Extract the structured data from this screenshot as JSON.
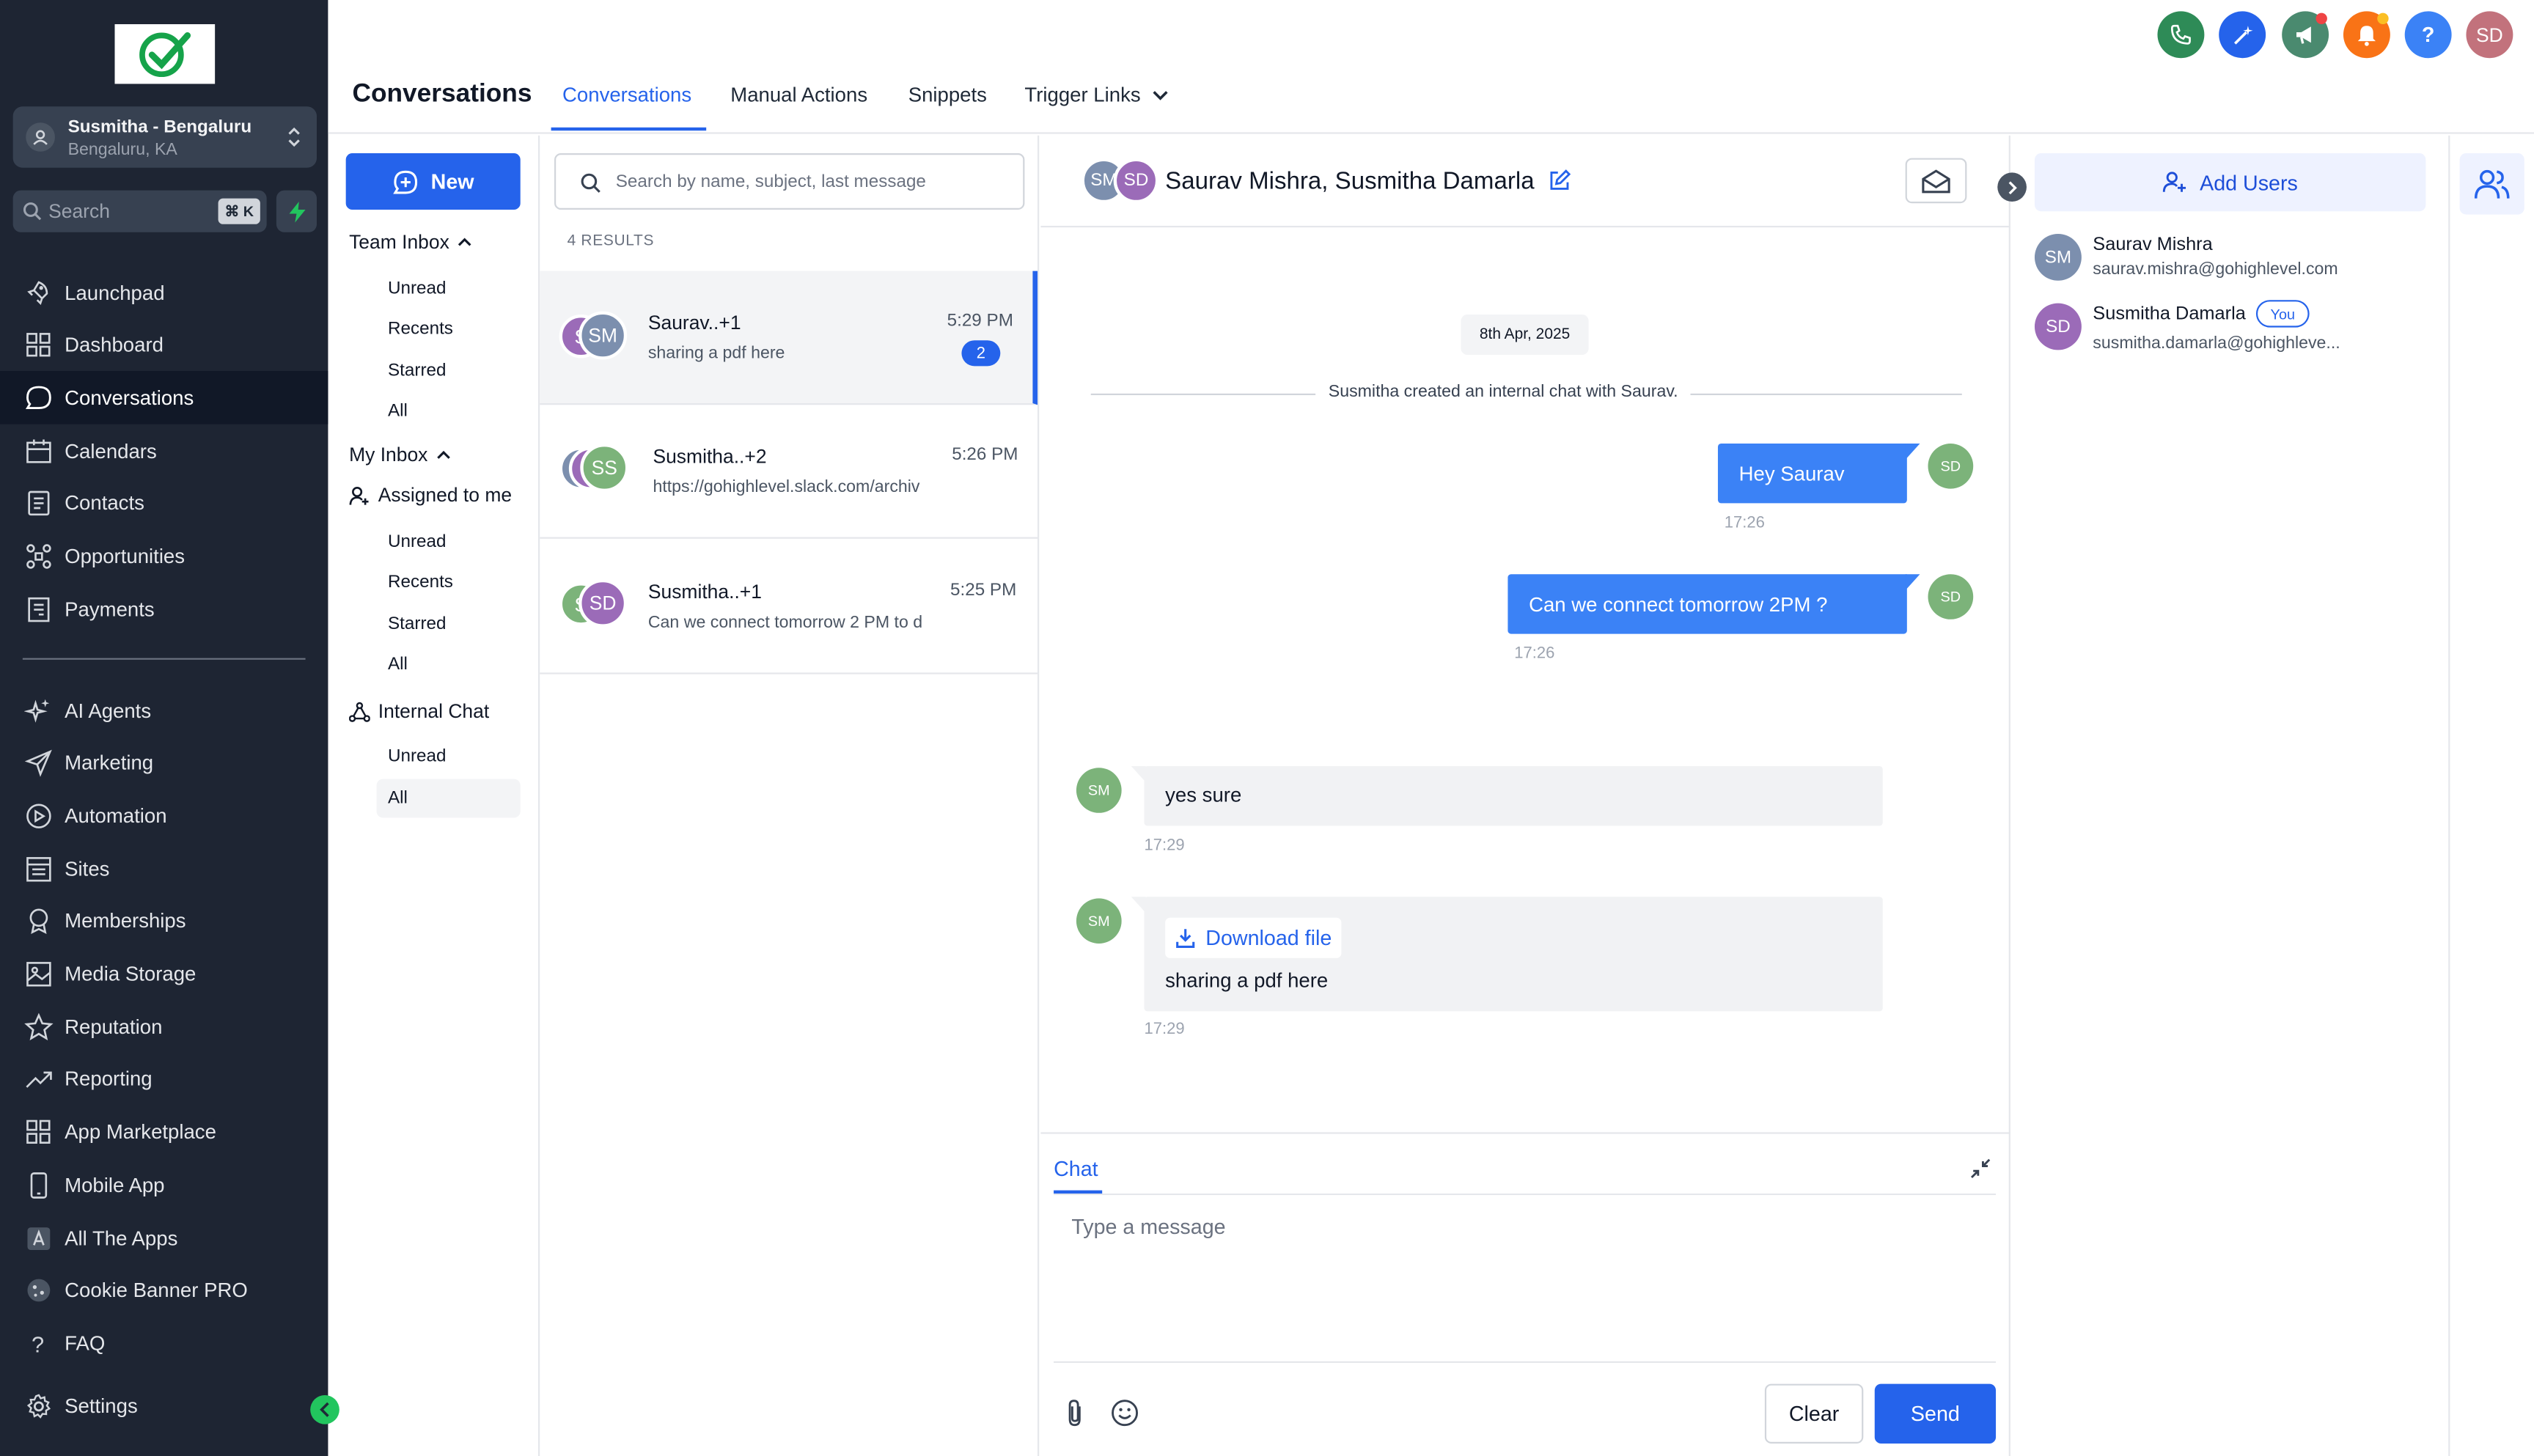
{
  "account": {
    "name": "Susmitha - Bengaluru",
    "location": "Bengaluru, KA"
  },
  "sidebar": {
    "search_placeholder": "Search",
    "search_shortcut": "⌘ K",
    "items": [
      {
        "label": "Launchpad",
        "icon": "rocket-icon"
      },
      {
        "label": "Dashboard",
        "icon": "grid-icon"
      },
      {
        "label": "Conversations",
        "icon": "chat-bubble-icon",
        "active": true
      },
      {
        "label": "Calendars",
        "icon": "calendar-icon"
      },
      {
        "label": "Contacts",
        "icon": "contacts-icon"
      },
      {
        "label": "Opportunities",
        "icon": "opportunities-icon"
      },
      {
        "label": "Payments",
        "icon": "payments-icon"
      }
    ],
    "items2": [
      {
        "label": "AI Agents",
        "icon": "sparkle-icon"
      },
      {
        "label": "Marketing",
        "icon": "send-icon"
      },
      {
        "label": "Automation",
        "icon": "automation-icon"
      },
      {
        "label": "Sites",
        "icon": "sites-icon"
      },
      {
        "label": "Memberships",
        "icon": "award-icon"
      },
      {
        "label": "Media Storage",
        "icon": "image-icon"
      },
      {
        "label": "Reputation",
        "icon": "star-icon"
      },
      {
        "label": "Reporting",
        "icon": "trending-up-icon"
      },
      {
        "label": "App Marketplace",
        "icon": "apps-icon"
      },
      {
        "label": "Mobile App",
        "icon": "mobile-icon"
      },
      {
        "label": "All The Apps",
        "icon": "app-store-icon"
      },
      {
        "label": "Cookie Banner PRO",
        "icon": "cookie-icon"
      },
      {
        "label": "FAQ",
        "icon": "question-icon"
      }
    ],
    "settings_label": "Settings"
  },
  "header": {
    "page_title": "Conversations",
    "tabs": [
      "Conversations",
      "Manual Actions",
      "Snippets",
      "Trigger Links"
    ],
    "avatar_initials": "SD"
  },
  "inbox": {
    "new_label": "New",
    "team_inbox": "Team Inbox",
    "team_items": [
      "Unread",
      "Recents",
      "Starred",
      "All"
    ],
    "my_inbox": "My Inbox",
    "assigned_to_me": "Assigned to me",
    "my_items": [
      "Unread",
      "Recents",
      "Starred",
      "All"
    ],
    "internal_chat": "Internal Chat",
    "internal_items": [
      "Unread",
      "All"
    ]
  },
  "conversations": {
    "search_placeholder": "Search by name, subject, last message",
    "results": "4 RESULTS",
    "items": [
      {
        "name": "Saurav..+1",
        "preview": "sharing a pdf here",
        "time": "5:29 PM",
        "badge": "2",
        "initials": [
          "S",
          "SM"
        ]
      },
      {
        "name": "Susmitha..+2",
        "preview": "https://gohighlevel.slack.com/archiv",
        "time": "5:26 PM",
        "initials": [
          "",
          "",
          "SS"
        ]
      },
      {
        "name": "Susmitha..+1",
        "preview": "Can we connect tomorrow 2 PM to d",
        "time": "5:25 PM",
        "initials": [
          "S",
          "SD"
        ]
      }
    ]
  },
  "chat": {
    "header_initials": [
      "SM",
      "SD"
    ],
    "title": "Saurav Mishra, Susmitha Damarla",
    "date": "8th Apr, 2025",
    "system_message": "Susmitha created an internal chat with Saurav.",
    "messages": [
      {
        "text": "Hey Saurav",
        "time": "17:26",
        "from": "SD"
      },
      {
        "text": "Can we connect tomorrow 2PM ?",
        "time": "17:26",
        "from": "SD"
      },
      {
        "text": "yes sure",
        "time": "17:29",
        "from": "SM"
      },
      {
        "download": "Download file",
        "text": "sharing a pdf here",
        "time": "17:29",
        "from": "SM"
      }
    ],
    "composer_tab": "Chat",
    "placeholder": "Type a message",
    "clear_label": "Clear",
    "send_label": "Send"
  },
  "users_panel": {
    "add_users": "Add Users",
    "users": [
      {
        "initials": "SM",
        "name": "Saurav Mishra",
        "email": "saurav.mishra@gohighlevel.com"
      },
      {
        "initials": "SD",
        "name": "Susmitha Damarla",
        "email": "susmitha.damarla@gohighleve...",
        "you": "You"
      }
    ]
  },
  "colors": {
    "primary": "#2563eb",
    "sidebar": "#1e2533",
    "sm_avatar": "#7c8fae",
    "sd_avatar": "#9b6bb8",
    "chat_green": "#7cb37a"
  }
}
